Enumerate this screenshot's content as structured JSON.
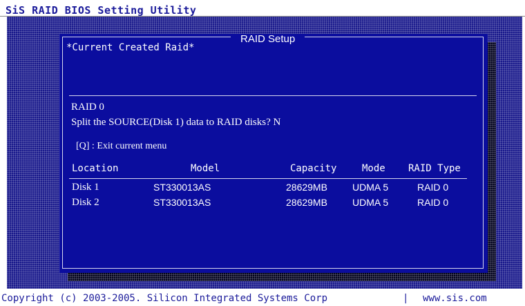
{
  "app": {
    "title": "SiS RAID BIOS Setting Utility"
  },
  "dialog": {
    "title": "RAID Setup",
    "current_raid_label": "*Current Created Raid*",
    "raid_level": "RAID 0",
    "split_question": "Split the SOURCE(Disk 1) data to RAID disks? N",
    "exit_hint": "[Q] : Exit current menu"
  },
  "table": {
    "headers": [
      "Location",
      "Model",
      "Capacity",
      "Mode",
      "RAID Type"
    ],
    "rows": [
      [
        "Disk 1",
        "ST330013AS",
        "28629MB",
        "UDMA 5",
        "RAID 0"
      ],
      [
        "Disk 2",
        "ST330013AS",
        "28629MB",
        "UDMA 5",
        "RAID 0"
      ]
    ]
  },
  "footer": {
    "copyright": "Copyright (c) 2003-2005. Silicon Integrated Systems Corp",
    "separator": "|",
    "website": "www.sis.com"
  },
  "colors": {
    "dialog_background": "#0b0d9e",
    "desktop_pattern": "#1a1a8c",
    "title_text": "#1a1a9a",
    "dialog_text": "#ffffff"
  }
}
